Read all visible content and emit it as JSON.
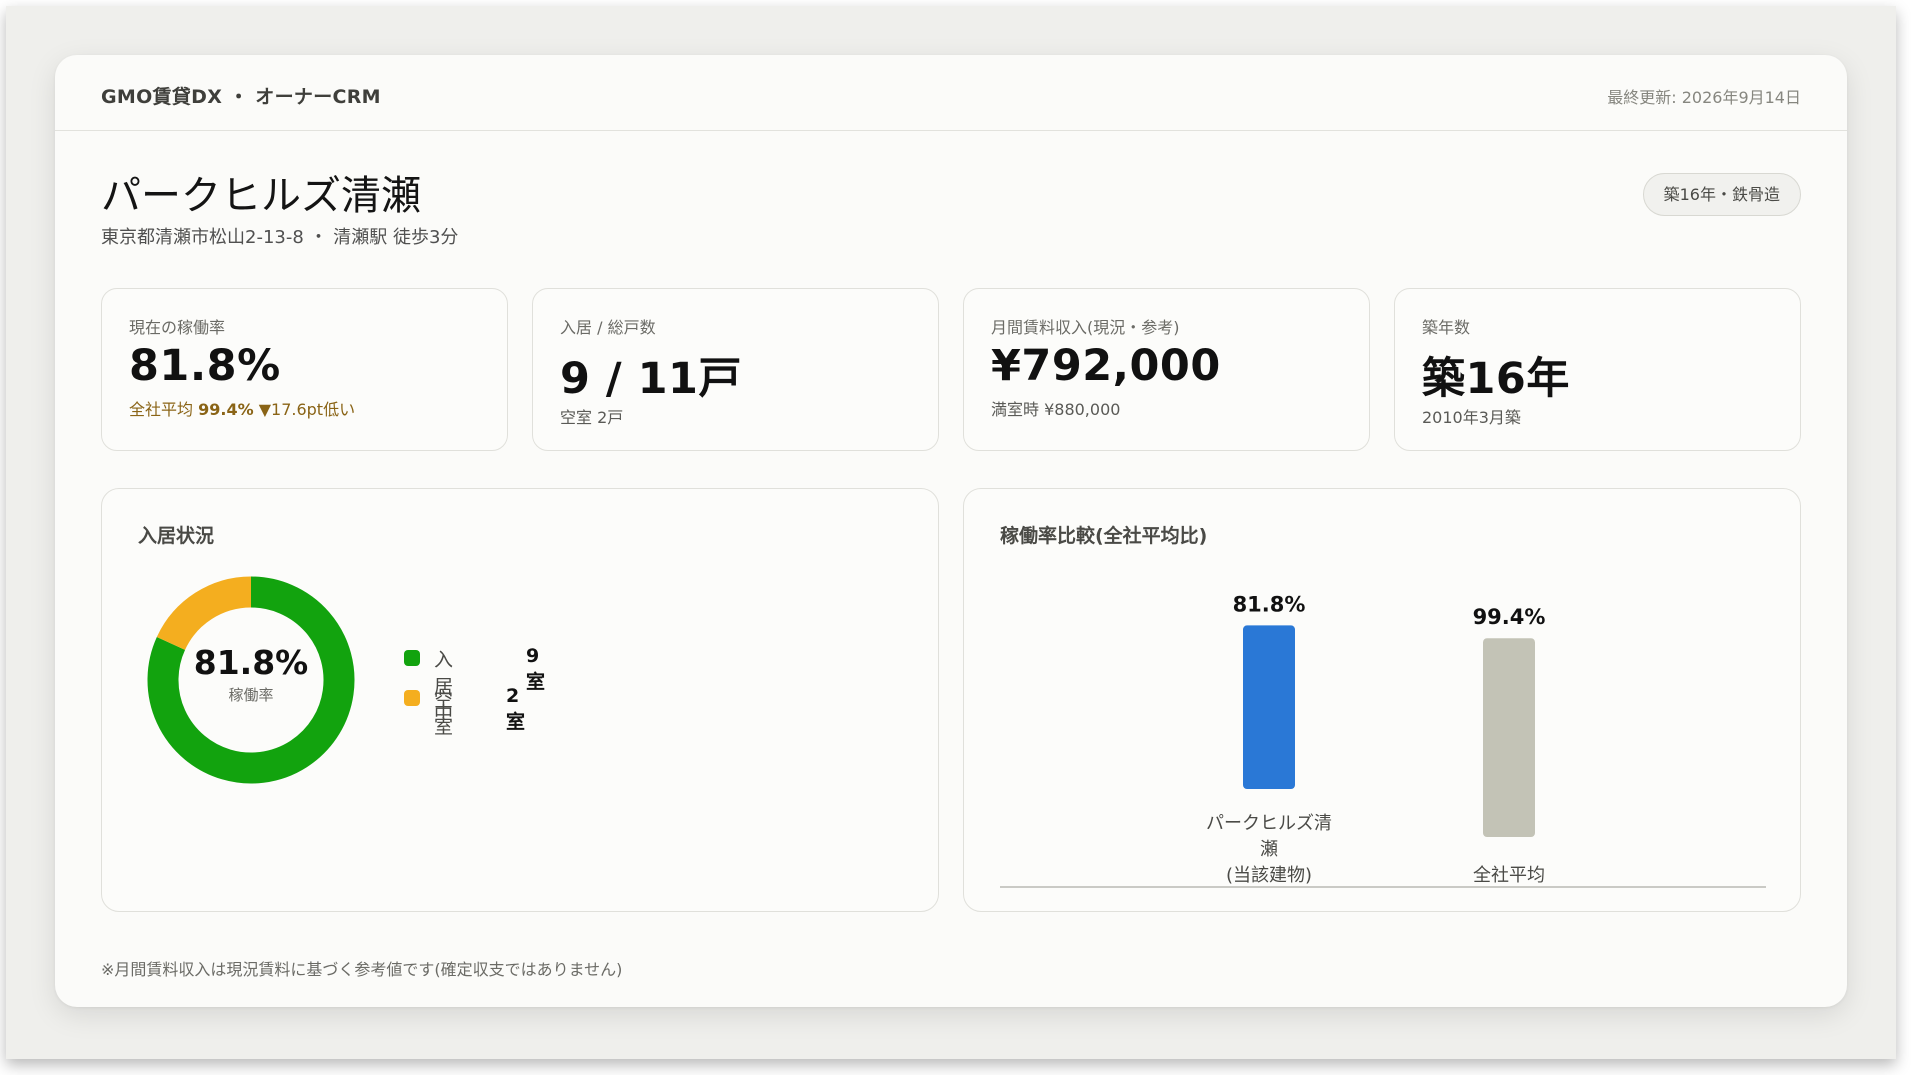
{
  "header": {
    "brand": "GMO賃貸DX ・ オーナーCRM",
    "updated": "最終更新: 2026年9月14日"
  },
  "property": {
    "name": "パークヒルズ清瀬",
    "address": "東京都清瀬市松山2-13-8 ・ 清瀬駅 徒歩3分",
    "badge": "築16年・鉄骨造"
  },
  "kpis": {
    "occupancy": {
      "label": "現在の稼働率",
      "value": "81.8%",
      "sub_prefix": "全社平均",
      "sub_avg": "99.4%",
      "sub_diff": "▼17.6pt低い"
    },
    "units": {
      "label": "入居 / 総戸数",
      "value": "9 / 11戸",
      "sub": "空室 2戸"
    },
    "income": {
      "label": "月間賃料収入(現況・参考)",
      "value": "¥792,000",
      "sub": "満室時 ¥880,000"
    },
    "age": {
      "label": "築年数",
      "value": "築16年",
      "sub": "2010年3月築"
    }
  },
  "occupancy_panel": {
    "title": "入居状況",
    "center_value": "81.8%",
    "center_caption": "稼働率",
    "legend": [
      {
        "name": "入居中",
        "count": "9室",
        "color": "#12a30e"
      },
      {
        "name": "空室",
        "count": "2室",
        "color": "#f4ae1f"
      }
    ]
  },
  "comparison_panel": {
    "title": "稼働率比較(全社平均比)"
  },
  "chart_data": [
    {
      "type": "pie",
      "categories": [
        "入居中",
        "空室"
      ],
      "values": [
        9,
        2
      ],
      "colors": [
        "#12a30e",
        "#f4ae1f"
      ]
    },
    {
      "type": "bar",
      "categories": [
        "パークヒルズ清瀬(当該建物)",
        "全社平均"
      ],
      "category_lines": [
        [
          "パークヒルズ清",
          "瀬",
          "(当該建物)"
        ],
        [
          "全社平均"
        ]
      ],
      "values": [
        81.8,
        99.4
      ],
      "value_labels": [
        "81.8%",
        "99.4%"
      ],
      "colors": [
        "#2a78d6",
        "#c3c3b6"
      ]
    }
  ],
  "footnote": "※月間賃料収入は現況賃料に基づく参考値です(確定収支ではありません)"
}
